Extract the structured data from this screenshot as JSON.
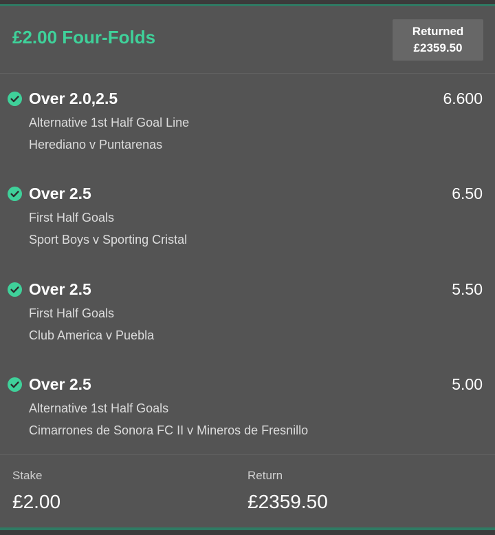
{
  "header": {
    "title": "£2.00 Four-Folds",
    "returned_label": "Returned",
    "returned_amount": "£2359.50"
  },
  "selections": [
    {
      "name": "Over 2.0,2.5",
      "odds": "6.600",
      "market": "Alternative 1st Half Goal Line",
      "event": "Herediano v Puntarenas",
      "status_icon": "check-circle-icon"
    },
    {
      "name": "Over 2.5",
      "odds": "6.50",
      "market": "First Half Goals",
      "event": "Sport Boys v Sporting Cristal",
      "status_icon": "check-circle-icon"
    },
    {
      "name": "Over 2.5",
      "odds": "5.50",
      "market": "First Half Goals",
      "event": "Club America v Puebla",
      "status_icon": "check-circle-icon"
    },
    {
      "name": "Over 2.5",
      "odds": "5.00",
      "market": "Alternative 1st Half Goals",
      "event": "Cimarrones de Sonora FC II v Mineros de Fresnillo",
      "status_icon": "check-circle-icon"
    }
  ],
  "footer": {
    "stake_label": "Stake",
    "stake_value": "£2.00",
    "return_label": "Return",
    "return_value": "£2359.50"
  },
  "colors": {
    "background": "#545454",
    "accent_green": "#3fd19a",
    "badge_bg": "#676767",
    "text_primary": "#ffffff",
    "text_secondary": "#dcdcdc"
  }
}
